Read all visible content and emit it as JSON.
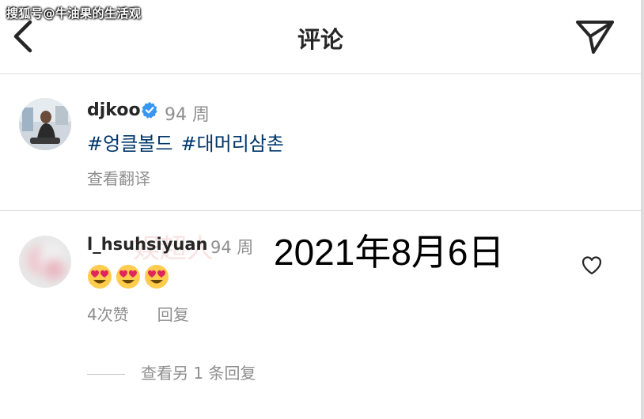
{
  "watermark": "搜狐号@牛油果的生活观",
  "header": {
    "title": "评论"
  },
  "post": {
    "username": "djkoo",
    "time": "94 周",
    "hashtags": [
      "#엉클볼드",
      "#대머리삼촌"
    ],
    "translate": "查看翻译"
  },
  "comment": {
    "username": "l_hsuhsiyuan",
    "time": "94 周",
    "emoji": "heart-eyes-face",
    "likes": "4次赞",
    "reply": "回复",
    "view_replies": "查看另 1 条回复"
  },
  "overlay": {
    "date": "2021年8月6日",
    "faint_watermark": "娱超人"
  },
  "colors": {
    "hashtag": "#00376b",
    "secondary": "#8e8e8e",
    "verified": "#3897f0",
    "divider": "#dbdbdb"
  }
}
